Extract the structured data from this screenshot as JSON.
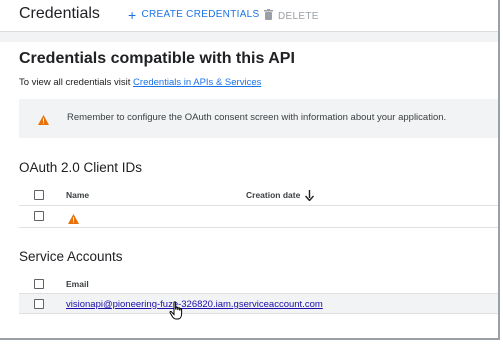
{
  "header": {
    "title": "Credentials",
    "create_label": "CREATE CREDENTIALS",
    "delete_label": "DELETE"
  },
  "main": {
    "heading": "Credentials compatible with this API",
    "intro_text": "To view all credentials visit",
    "intro_link": "Credentials in APIs & Services"
  },
  "alert": {
    "message": "Remember to configure the OAuth consent screen with information about your application."
  },
  "oauth": {
    "section_title": "OAuth 2.0 Client IDs",
    "columns": [
      "Name",
      "Creation date"
    ],
    "sort_indicator": "arrow-down-icon",
    "rows": [
      {
        "status_icon": "warning-icon"
      }
    ]
  },
  "service_accounts": {
    "section_title": "Service Accounts",
    "columns": [
      "Email"
    ],
    "rows": [
      {
        "email": "visionapi@pioneering-fuze-326820.iam.gserviceaccount.com"
      }
    ]
  },
  "colors": {
    "accent": "#1a73e8",
    "warning": "#e8710a",
    "disabled": "#9aa0a6"
  }
}
